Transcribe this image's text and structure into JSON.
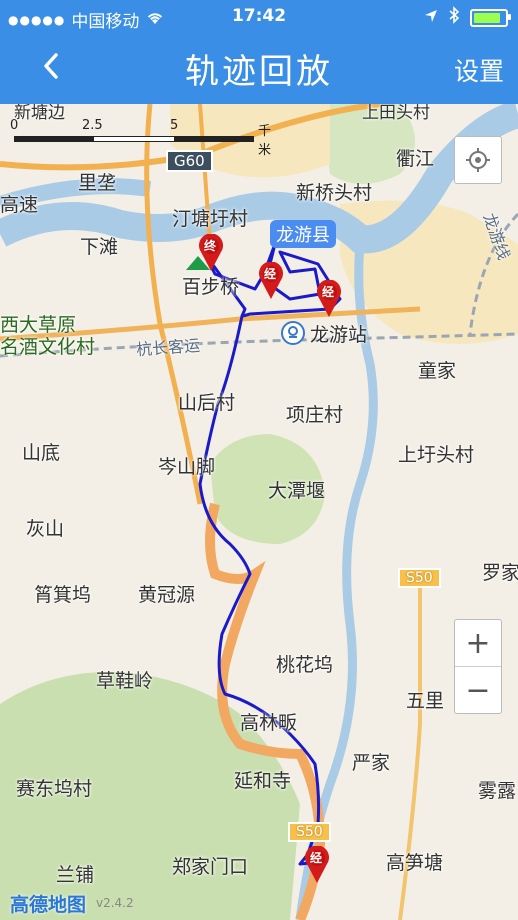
{
  "statusbar": {
    "signal": "●●●●●",
    "carrier": "中国移动",
    "time": "17:42"
  },
  "navbar": {
    "back_icon": "chevron-left-icon",
    "title": "轨迹回放",
    "settings_label": "设置"
  },
  "map": {
    "scale": {
      "tick0": "0",
      "tick1": "2.5",
      "tick2": "5",
      "unit": "千米"
    },
    "labels": {
      "xintangbian": "新塘边",
      "lijian": "里垄",
      "gaosu": "高速",
      "g60": "G60",
      "tingtangganc": "汀塘圩村",
      "xiatan": "下滩",
      "baibuqiao": "百步桥",
      "xinqiaotoucun": "新桥头村",
      "longyouxian": "龙游县",
      "quzhou": "衢江",
      "hangchangkeyun": "杭长客运",
      "longyouzhan": "龙游站",
      "xidacaoyuan": "西大草原",
      "mingjiu": "名酒文化村",
      "tongjia": "童家",
      "shanhoucun": "山后村",
      "xiangzhuangcun": "项庄村",
      "shandi": "山底",
      "censhanjiao": "岑山脚",
      "shangqiantoucun": "上圩头村",
      "datanyan": "大潭堰",
      "huishan": "灰山",
      "qunwu": "筲箕坞",
      "huangguanyuan": "黄冠源",
      "s50a": "S50",
      "luojia": "罗家",
      "taohuawu": "桃花坞",
      "caoxieling": "草鞋岭",
      "wulili": "五里",
      "gaolinfan": "高林畈",
      "yanjia": "严家",
      "saidongwucun": "赛东坞村",
      "yanhesi": "延和寺",
      "wulu": "雾露",
      "s50b": "S50",
      "lanpu": "兰铺",
      "zhengjiamenkou": "郑家门口",
      "gaosuntang": "高笋塘",
      "shangtanan": "上田头村",
      "lianxian": "龙游线"
    },
    "markers": {
      "end_label": "终",
      "pass_label": "经"
    },
    "logo": "高德地图",
    "version": "v2.4.2",
    "zoom_in": "+",
    "zoom_out": "−"
  }
}
